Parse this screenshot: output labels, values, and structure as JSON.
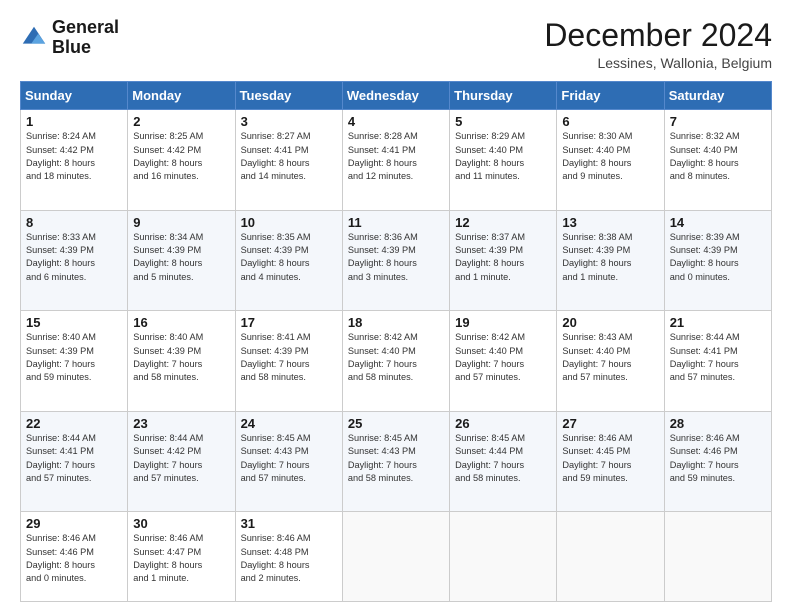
{
  "header": {
    "logo_line1": "General",
    "logo_line2": "Blue",
    "month_title": "December 2024",
    "location": "Lessines, Wallonia, Belgium"
  },
  "weekdays": [
    "Sunday",
    "Monday",
    "Tuesday",
    "Wednesday",
    "Thursday",
    "Friday",
    "Saturday"
  ],
  "weeks": [
    [
      {
        "day": "1",
        "info": "Sunrise: 8:24 AM\nSunset: 4:42 PM\nDaylight: 8 hours\nand 18 minutes."
      },
      {
        "day": "2",
        "info": "Sunrise: 8:25 AM\nSunset: 4:42 PM\nDaylight: 8 hours\nand 16 minutes."
      },
      {
        "day": "3",
        "info": "Sunrise: 8:27 AM\nSunset: 4:41 PM\nDaylight: 8 hours\nand 14 minutes."
      },
      {
        "day": "4",
        "info": "Sunrise: 8:28 AM\nSunset: 4:41 PM\nDaylight: 8 hours\nand 12 minutes."
      },
      {
        "day": "5",
        "info": "Sunrise: 8:29 AM\nSunset: 4:40 PM\nDaylight: 8 hours\nand 11 minutes."
      },
      {
        "day": "6",
        "info": "Sunrise: 8:30 AM\nSunset: 4:40 PM\nDaylight: 8 hours\nand 9 minutes."
      },
      {
        "day": "7",
        "info": "Sunrise: 8:32 AM\nSunset: 4:40 PM\nDaylight: 8 hours\nand 8 minutes."
      }
    ],
    [
      {
        "day": "8",
        "info": "Sunrise: 8:33 AM\nSunset: 4:39 PM\nDaylight: 8 hours\nand 6 minutes."
      },
      {
        "day": "9",
        "info": "Sunrise: 8:34 AM\nSunset: 4:39 PM\nDaylight: 8 hours\nand 5 minutes."
      },
      {
        "day": "10",
        "info": "Sunrise: 8:35 AM\nSunset: 4:39 PM\nDaylight: 8 hours\nand 4 minutes."
      },
      {
        "day": "11",
        "info": "Sunrise: 8:36 AM\nSunset: 4:39 PM\nDaylight: 8 hours\nand 3 minutes."
      },
      {
        "day": "12",
        "info": "Sunrise: 8:37 AM\nSunset: 4:39 PM\nDaylight: 8 hours\nand 1 minute."
      },
      {
        "day": "13",
        "info": "Sunrise: 8:38 AM\nSunset: 4:39 PM\nDaylight: 8 hours\nand 1 minute."
      },
      {
        "day": "14",
        "info": "Sunrise: 8:39 AM\nSunset: 4:39 PM\nDaylight: 8 hours\nand 0 minutes."
      }
    ],
    [
      {
        "day": "15",
        "info": "Sunrise: 8:40 AM\nSunset: 4:39 PM\nDaylight: 7 hours\nand 59 minutes."
      },
      {
        "day": "16",
        "info": "Sunrise: 8:40 AM\nSunset: 4:39 PM\nDaylight: 7 hours\nand 58 minutes."
      },
      {
        "day": "17",
        "info": "Sunrise: 8:41 AM\nSunset: 4:39 PM\nDaylight: 7 hours\nand 58 minutes."
      },
      {
        "day": "18",
        "info": "Sunrise: 8:42 AM\nSunset: 4:40 PM\nDaylight: 7 hours\nand 58 minutes."
      },
      {
        "day": "19",
        "info": "Sunrise: 8:42 AM\nSunset: 4:40 PM\nDaylight: 7 hours\nand 57 minutes."
      },
      {
        "day": "20",
        "info": "Sunrise: 8:43 AM\nSunset: 4:40 PM\nDaylight: 7 hours\nand 57 minutes."
      },
      {
        "day": "21",
        "info": "Sunrise: 8:44 AM\nSunset: 4:41 PM\nDaylight: 7 hours\nand 57 minutes."
      }
    ],
    [
      {
        "day": "22",
        "info": "Sunrise: 8:44 AM\nSunset: 4:41 PM\nDaylight: 7 hours\nand 57 minutes."
      },
      {
        "day": "23",
        "info": "Sunrise: 8:44 AM\nSunset: 4:42 PM\nDaylight: 7 hours\nand 57 minutes."
      },
      {
        "day": "24",
        "info": "Sunrise: 8:45 AM\nSunset: 4:43 PM\nDaylight: 7 hours\nand 57 minutes."
      },
      {
        "day": "25",
        "info": "Sunrise: 8:45 AM\nSunset: 4:43 PM\nDaylight: 7 hours\nand 58 minutes."
      },
      {
        "day": "26",
        "info": "Sunrise: 8:45 AM\nSunset: 4:44 PM\nDaylight: 7 hours\nand 58 minutes."
      },
      {
        "day": "27",
        "info": "Sunrise: 8:46 AM\nSunset: 4:45 PM\nDaylight: 7 hours\nand 59 minutes."
      },
      {
        "day": "28",
        "info": "Sunrise: 8:46 AM\nSunset: 4:46 PM\nDaylight: 7 hours\nand 59 minutes."
      }
    ],
    [
      {
        "day": "29",
        "info": "Sunrise: 8:46 AM\nSunset: 4:46 PM\nDaylight: 8 hours\nand 0 minutes."
      },
      {
        "day": "30",
        "info": "Sunrise: 8:46 AM\nSunset: 4:47 PM\nDaylight: 8 hours\nand 1 minute."
      },
      {
        "day": "31",
        "info": "Sunrise: 8:46 AM\nSunset: 4:48 PM\nDaylight: 8 hours\nand 2 minutes."
      },
      null,
      null,
      null,
      null
    ]
  ]
}
